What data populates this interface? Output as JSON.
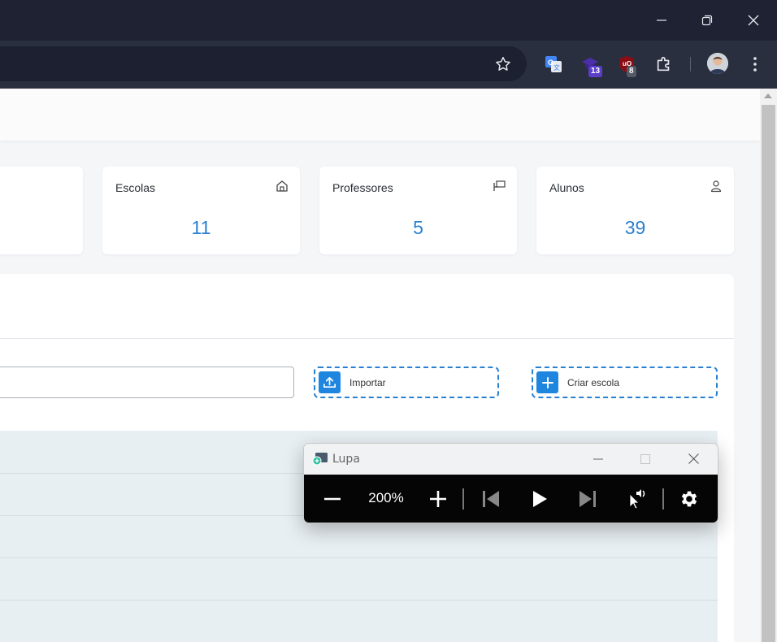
{
  "browser": {
    "window_controls": [
      "minimize",
      "restore",
      "close"
    ],
    "extensions": [
      {
        "icon": "google-translate-icon",
        "badge": ""
      },
      {
        "icon": "graduation-cap-icon",
        "badge": "13"
      },
      {
        "icon": "ublock-icon",
        "badge": "8"
      },
      {
        "icon": "puzzle-icon",
        "badge": ""
      }
    ]
  },
  "cards": [
    {
      "title": "Escolas",
      "value": "11",
      "icon": "school-icon"
    },
    {
      "title": "Professores",
      "value": "5",
      "icon": "teacher-icon"
    },
    {
      "title": "Alunos",
      "value": "39",
      "icon": "user-icon"
    }
  ],
  "actions": {
    "import_label": "Importar",
    "create_label": "Criar escola"
  },
  "magnifier": {
    "title": "Lupa",
    "zoom": "200%"
  },
  "colors": {
    "accent": "#2a80d0",
    "titlebar": "#1e2233"
  }
}
